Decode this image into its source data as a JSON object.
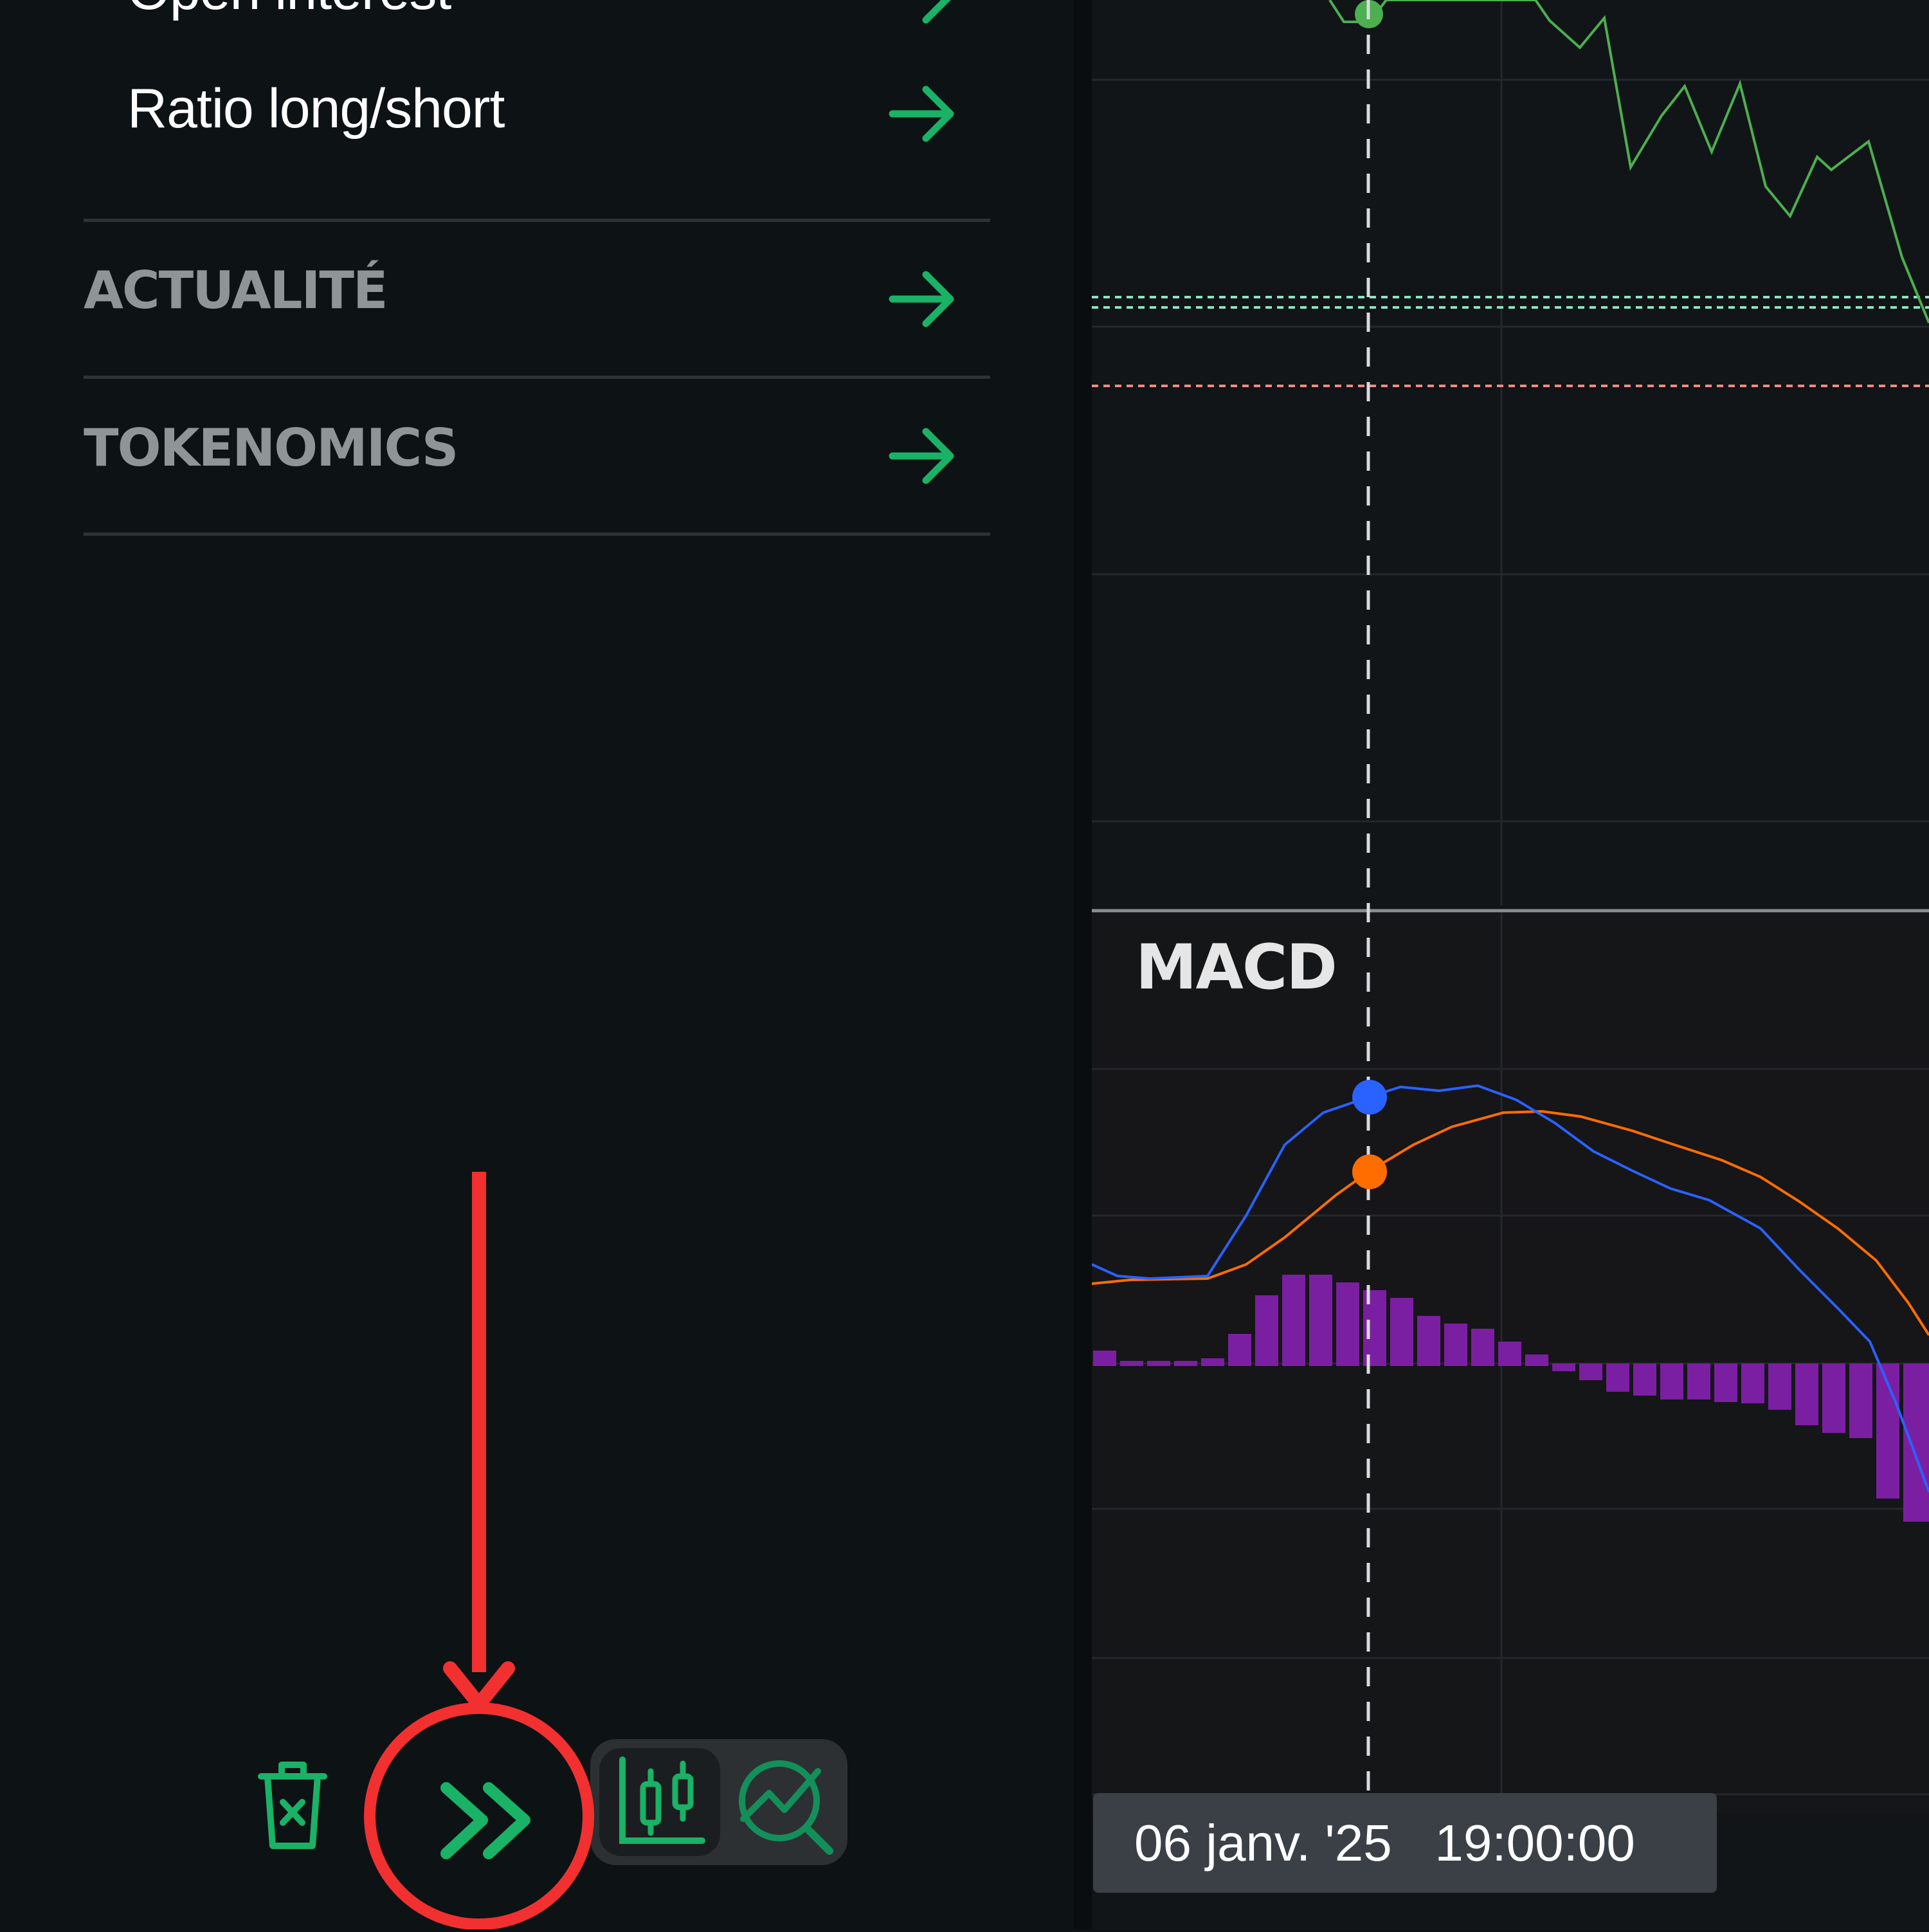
{
  "sidebar": {
    "items": [
      {
        "label": "Open interest",
        "type": "subitem"
      },
      {
        "label": "Ratio long/short",
        "type": "subitem"
      },
      {
        "label": "ACTUALITÉ",
        "type": "section"
      },
      {
        "label": "TOKENOMICS",
        "type": "section"
      }
    ],
    "arrow_icon": "arrow-right-icon",
    "accent_color": "#19b266"
  },
  "toolbar": {
    "trash_icon": "trash-clear-icon",
    "collapse_icon": "double-chevron-right-icon",
    "view_candles_icon": "candlestick-chart-icon",
    "view_analysis_icon": "chart-search-icon"
  },
  "chart": {
    "indicator_label": "MACD",
    "crosshair_time": "06 janv. '25   19:00:00",
    "colors": {
      "price_line": "#4caf50",
      "macd_line": "#2962ff",
      "signal_line": "#ff6d00",
      "histogram": "#7b1fa2",
      "level_green": "#8fe3c0",
      "level_red": "#f28b82"
    }
  },
  "annotation": {
    "color": "#f23030"
  }
}
